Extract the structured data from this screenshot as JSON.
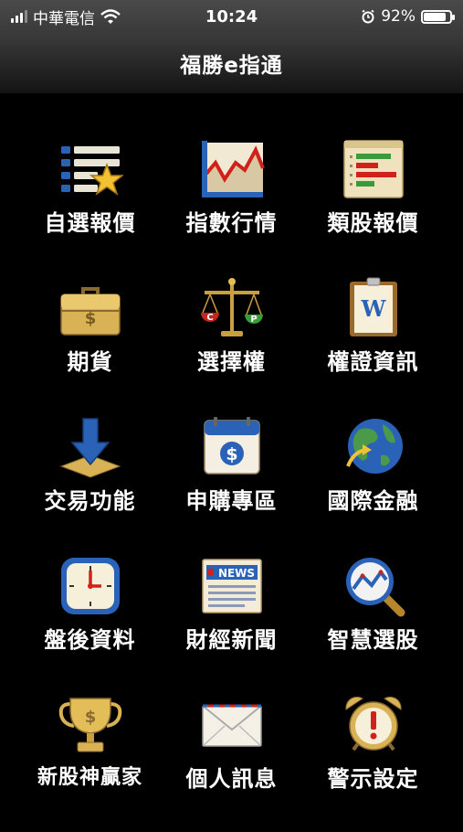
{
  "status_bar": {
    "carrier": "中華電信",
    "time": "10:24",
    "battery_percent_label": "92%",
    "battery_level": 0.92
  },
  "header": {
    "title": "福勝e指通"
  },
  "menu": [
    {
      "label": "自選報價",
      "icon": "watchlist-star-icon"
    },
    {
      "label": "指數行情",
      "icon": "index-chart-icon"
    },
    {
      "label": "類股報價",
      "icon": "sector-bars-icon"
    },
    {
      "label": "期貨",
      "icon": "briefcase-dollar-icon"
    },
    {
      "label": "選擇權",
      "icon": "scale-cp-icon",
      "icon_text": [
        "C",
        "P"
      ]
    },
    {
      "label": "權證資訊",
      "icon": "warrant-document-icon",
      "icon_text": "W"
    },
    {
      "label": "交易功能",
      "icon": "download-arrow-icon"
    },
    {
      "label": "申購專區",
      "icon": "calendar-dollar-icon"
    },
    {
      "label": "國際金融",
      "icon": "globe-icon"
    },
    {
      "label": "盤後資料",
      "icon": "clock-icon"
    },
    {
      "label": "財經新聞",
      "icon": "newspaper-icon",
      "icon_text": "NEWS"
    },
    {
      "label": "智慧選股",
      "icon": "magnifier-chart-icon"
    },
    {
      "label": "新股神贏家",
      "icon": "trophy-dollar-icon"
    },
    {
      "label": "個人訊息",
      "icon": "envelope-icon"
    },
    {
      "label": "警示設定",
      "icon": "alarm-clock-icon"
    }
  ]
}
